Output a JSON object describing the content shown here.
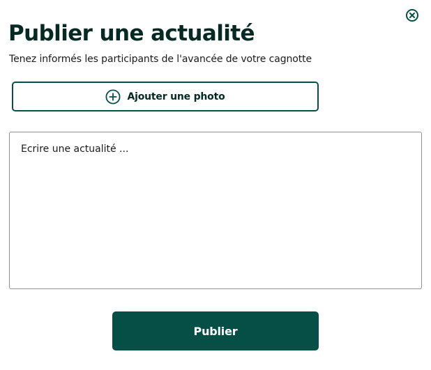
{
  "modal": {
    "title": "Publier une actualité",
    "subtitle": "Tenez informés les participants de l'avancée de votre cagnotte",
    "close_icon": "close-icon"
  },
  "add_photo": {
    "label": "Ajouter une photo",
    "icon": "plus-circle-icon"
  },
  "news_input": {
    "placeholder": "Ecrire une actualité ...",
    "value": ""
  },
  "publish": {
    "label": "Publier"
  },
  "colors": {
    "primary": "#064f47",
    "title": "#062a23",
    "text": "#1a1a1a",
    "border": "#8f8f8f"
  }
}
